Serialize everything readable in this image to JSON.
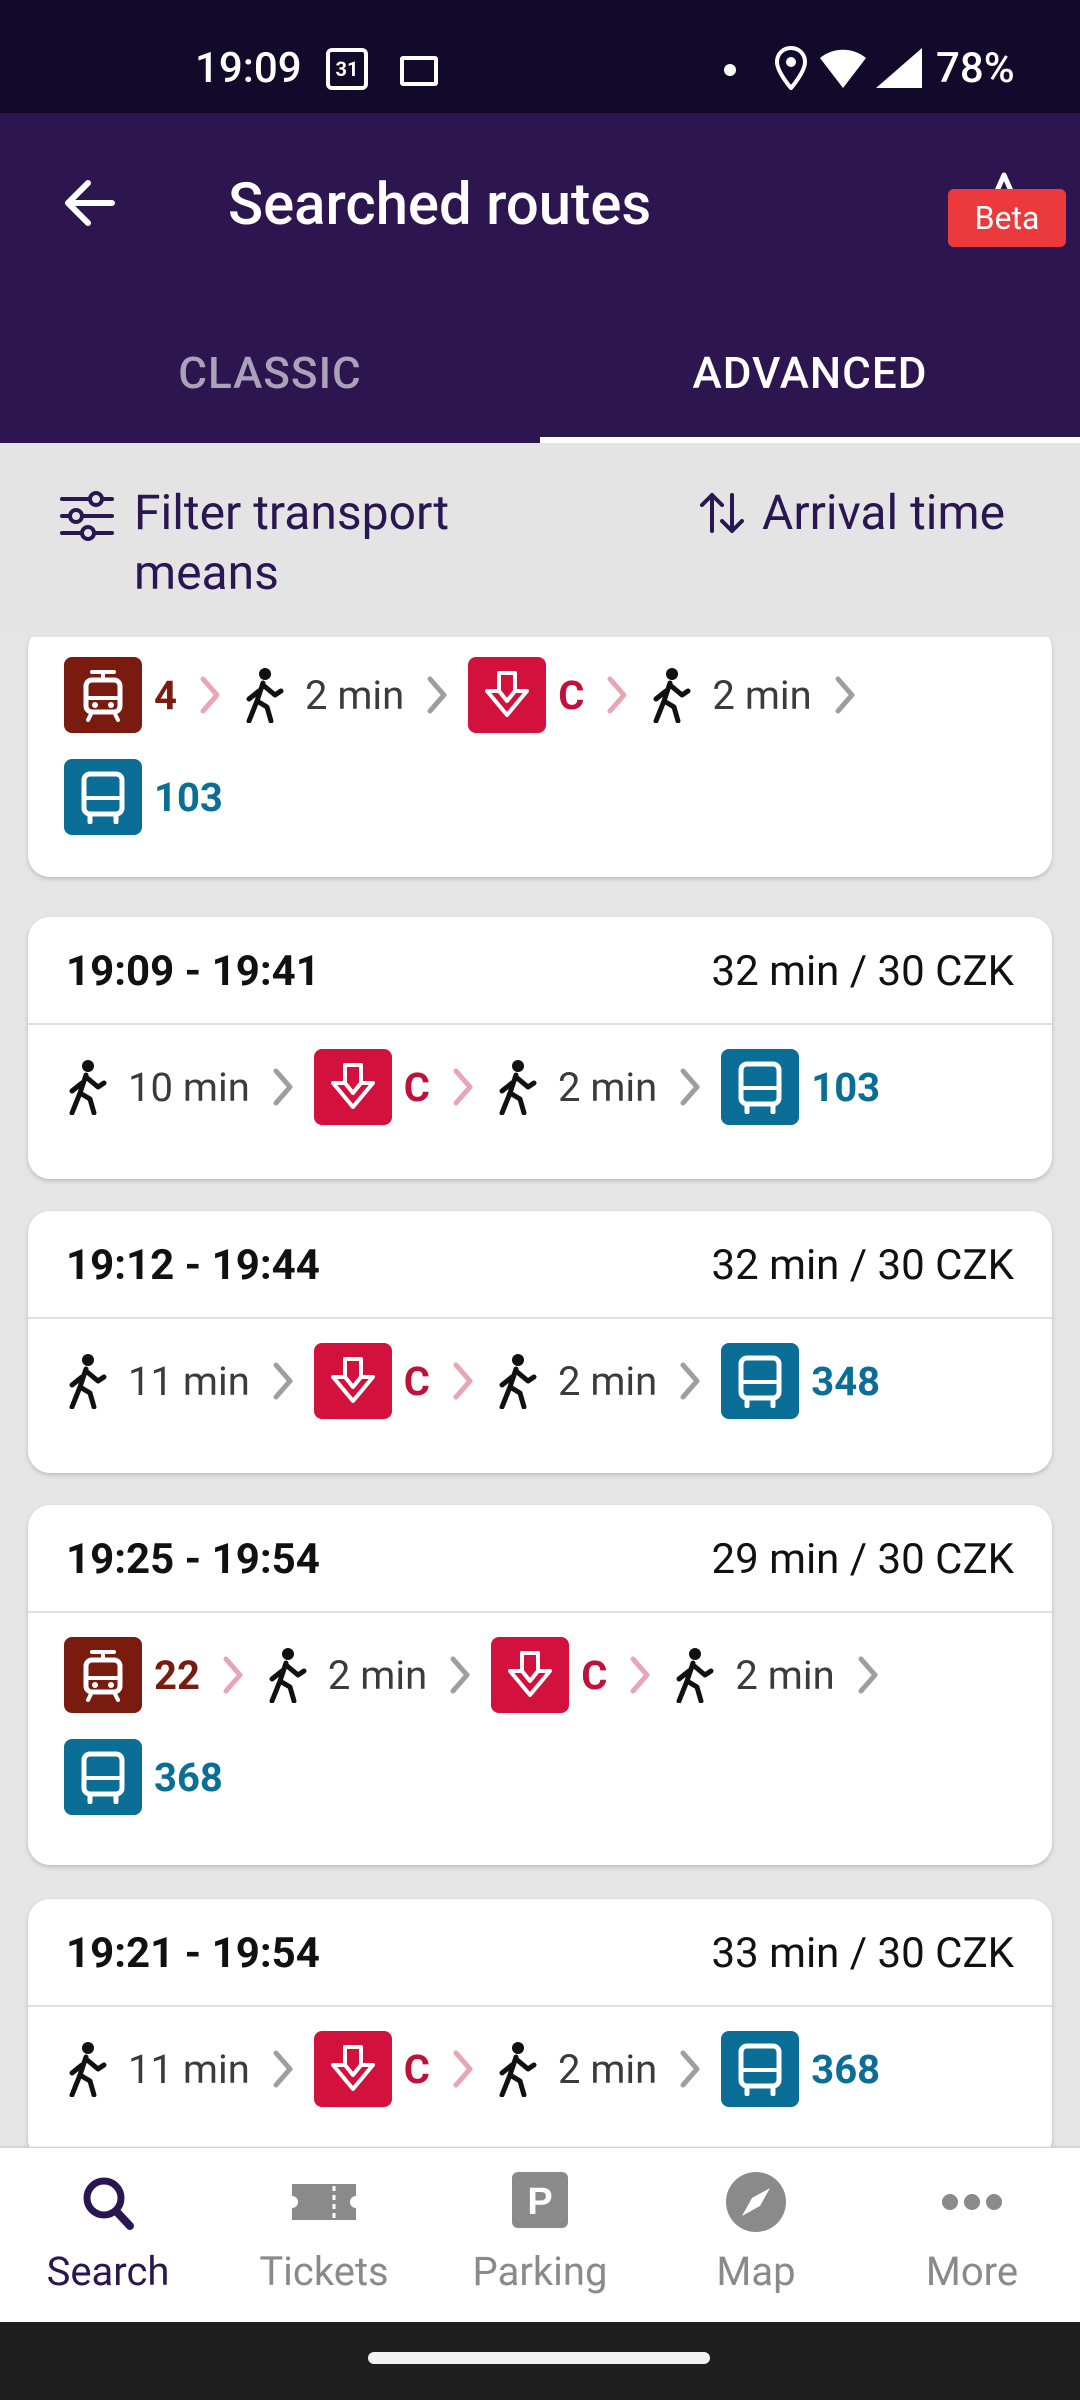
{
  "status_bar": {
    "time": "19:09",
    "calendar_day": "31",
    "battery": "78%"
  },
  "header": {
    "title": "Searched routes",
    "tabs": [
      {
        "label": "CLASSIC",
        "selected": false
      },
      {
        "label": "ADVANCED",
        "selected": true
      }
    ],
    "beta_badge": "Beta"
  },
  "toolbar": {
    "filter_label": "Filter transport means",
    "sort_label": "Arrival time"
  },
  "colors": {
    "primary": "#2d154f",
    "tram": "#7a1b10",
    "metro": "#d3113d",
    "bus": "#0a6e97",
    "beta": "#ec3a3c"
  },
  "routes": [
    {
      "times": "",
      "summary": "",
      "partial": true,
      "legs": [
        {
          "type": "tram",
          "line": "4"
        },
        {
          "type": "walk",
          "text": "2 min"
        },
        {
          "type": "metro",
          "line": "C"
        },
        {
          "type": "walk",
          "text": "2 min"
        },
        {
          "type": "bus",
          "line": "103"
        }
      ]
    },
    {
      "times": "19:09 - 19:41",
      "summary": "32 min / 30 CZK",
      "legs": [
        {
          "type": "walk",
          "text": "10 min"
        },
        {
          "type": "metro",
          "line": "C"
        },
        {
          "type": "walk",
          "text": "2 min"
        },
        {
          "type": "bus",
          "line": "103"
        }
      ]
    },
    {
      "times": "19:12 - 19:44",
      "summary": "32 min / 30 CZK",
      "legs": [
        {
          "type": "walk",
          "text": "11 min"
        },
        {
          "type": "metro",
          "line": "C"
        },
        {
          "type": "walk",
          "text": "2 min"
        },
        {
          "type": "bus",
          "line": "348"
        }
      ]
    },
    {
      "times": "19:25 - 19:54",
      "summary": "29 min / 30 CZK",
      "legs": [
        {
          "type": "tram",
          "line": "22"
        },
        {
          "type": "walk",
          "text": "2 min"
        },
        {
          "type": "metro",
          "line": "C"
        },
        {
          "type": "walk",
          "text": "2 min"
        },
        {
          "type": "bus",
          "line": "368"
        }
      ]
    },
    {
      "times": "19:21 - 19:54",
      "summary": "33 min / 30 CZK",
      "legs": [
        {
          "type": "walk",
          "text": "11 min"
        },
        {
          "type": "metro",
          "line": "C"
        },
        {
          "type": "walk",
          "text": "2 min"
        },
        {
          "type": "bus",
          "line": "368"
        }
      ]
    }
  ],
  "bottom_nav": [
    {
      "label": "Search",
      "icon": "search-icon",
      "active": true
    },
    {
      "label": "Tickets",
      "icon": "ticket-icon",
      "active": false
    },
    {
      "label": "Parking",
      "icon": "parking-icon",
      "active": false
    },
    {
      "label": "Map",
      "icon": "compass-icon",
      "active": false
    },
    {
      "label": "More",
      "icon": "more-icon",
      "active": false
    }
  ]
}
